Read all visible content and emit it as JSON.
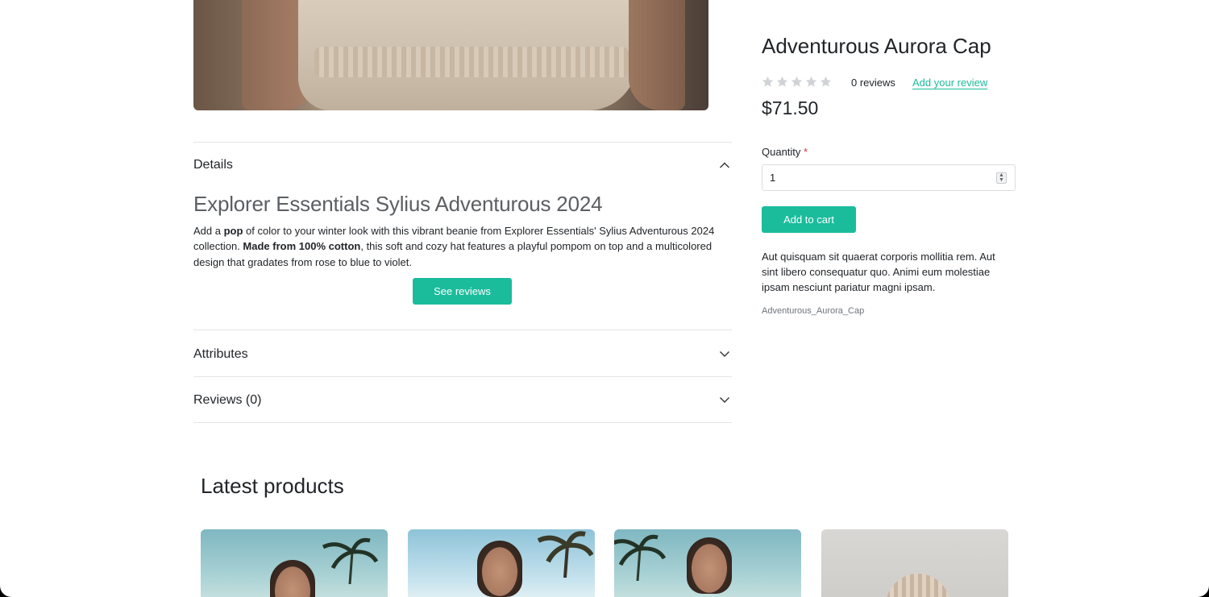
{
  "product": {
    "title": "Adventurous Aurora Cap",
    "rating": 0,
    "reviews_count": "0 reviews",
    "add_review": "Add your review",
    "price": "$71.50",
    "quantity_label": "Quantity",
    "quantity_required": "*",
    "quantity_value": "1",
    "add_to_cart": "Add to cart",
    "short_description": "Aut quisquam sit quaerat corporis mollitia rem. Aut sint libero consequatur quo. Animi eum molestiae ipsam nesciunt pariatur magni ipsam.",
    "code": "Adventurous_Aurora_Cap"
  },
  "accordion": {
    "details": {
      "title": "Details",
      "heading": "Explorer Essentials Sylius Adventurous 2024",
      "text_1": "Add a ",
      "text_bold_1": "pop",
      "text_2": " of color to your winter look with this vibrant beanie from Explorer Essentials' Sylius Adventurous 2024 collection. ",
      "text_bold_2": "Made from 100% cotton",
      "text_3": ", this soft and cozy hat features a playful pompom on top and a multicolored design that gradates from rose to blue to violet.",
      "see_reviews": "See reviews"
    },
    "attributes": {
      "title": "Attributes"
    },
    "reviews": {
      "title": "Reviews (0)"
    }
  },
  "latest": {
    "title": "Latest products"
  },
  "colors": {
    "accent": "#1abc9c",
    "required": "#dc3545",
    "star_empty": "#d0d3d6"
  },
  "icons": {
    "expanded": "chevron-up-icon",
    "collapsed": "chevron-down-icon",
    "rating": "star-icon"
  }
}
